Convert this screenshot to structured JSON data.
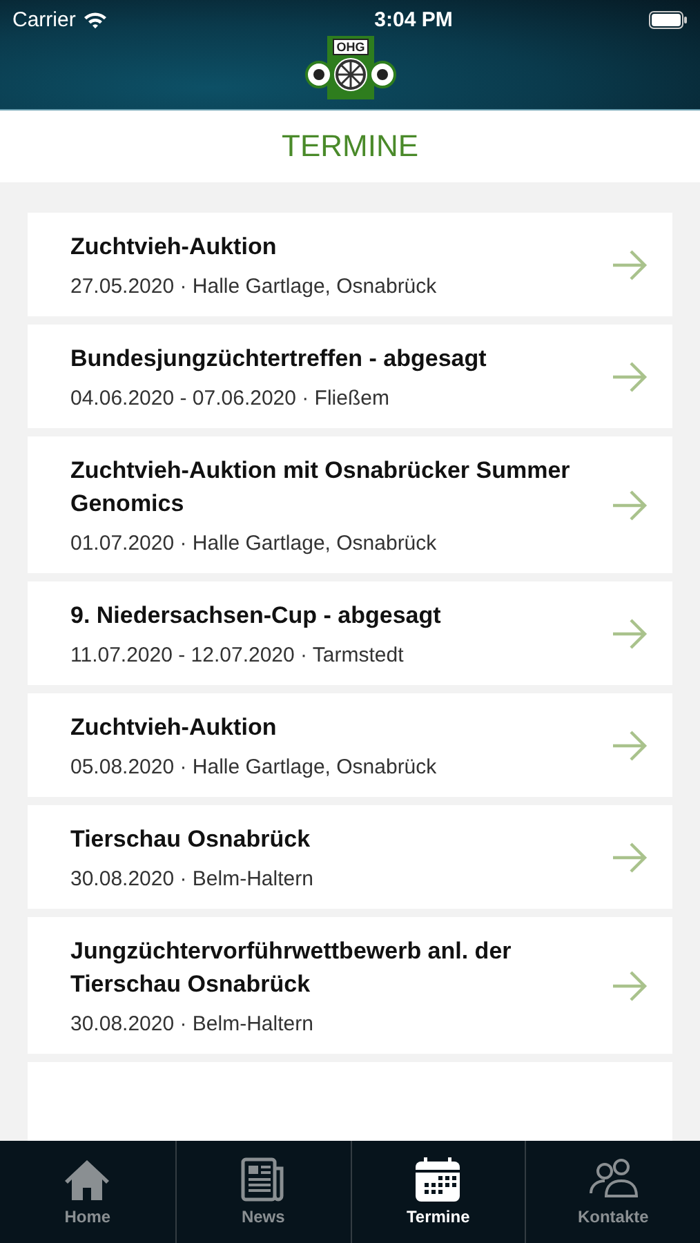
{
  "status_bar": {
    "carrier": "Carrier",
    "time": "3:04 PM"
  },
  "logo": {
    "text": "OHG"
  },
  "page_title": "TERMINE",
  "events": [
    {
      "title": "Zuchtvieh-Auktion",
      "details": "27.05.2020 · Halle Gartlage, Osnabrück"
    },
    {
      "title": "Bundesjungzüchtertreffen - abgesagt",
      "details": "04.06.2020 - 07.06.2020 · Fließem"
    },
    {
      "title": "Zuchtvieh-Auktion mit Osnabrücker Summer Genomics",
      "details": "01.07.2020 · Halle Gartlage, Osnabrück"
    },
    {
      "title": "9. Niedersachsen-Cup - abgesagt",
      "details": "11.07.2020 - 12.07.2020 · Tarmstedt"
    },
    {
      "title": "Zuchtvieh-Auktion",
      "details": "05.08.2020 · Halle Gartlage, Osnabrück"
    },
    {
      "title": "Tierschau Osnabrück",
      "details": "30.08.2020 · Belm-Haltern"
    },
    {
      "title": "Jungzüchtervorführwettbewerb anl. der Tierschau Osnabrück",
      "details": "30.08.2020 · Belm-Haltern"
    }
  ],
  "tabs": [
    {
      "kind": "home",
      "label": "Home",
      "selected": false
    },
    {
      "kind": "news",
      "label": "News",
      "selected": false
    },
    {
      "kind": "calendar",
      "label": "Termine",
      "selected": true
    },
    {
      "kind": "contacts",
      "label": "Kontakte",
      "selected": false
    }
  ]
}
